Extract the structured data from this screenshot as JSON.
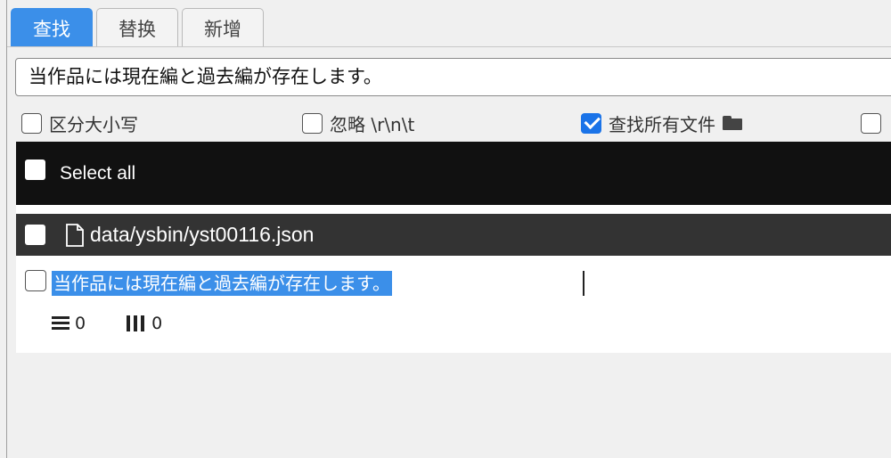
{
  "tabs": [
    {
      "label": "查找",
      "active": true
    },
    {
      "label": "替换",
      "active": false
    },
    {
      "label": "新增",
      "active": false
    }
  ],
  "search": {
    "value": "当作品には現在編と過去編が存在します。"
  },
  "options": {
    "case_sensitive": {
      "label": "区分大小写",
      "checked": false
    },
    "ignore_escapes": {
      "label": "忽略 \\r\\n\\t",
      "checked": false
    },
    "find_all_files": {
      "label": "查找所有文件",
      "checked": true,
      "icon": "folder-icon"
    },
    "fourth": {
      "checked": false
    }
  },
  "results": {
    "select_all_label": "Select all",
    "file": {
      "path": "data/ysbin/yst00116.json",
      "icon": "file-icon"
    },
    "match": {
      "text": "当作品には現在編と過去編が存在します。",
      "line": "0",
      "column": "0"
    }
  },
  "colors": {
    "accent": "#3b8fe9",
    "header_bar": "#111111",
    "file_bar": "#333333"
  }
}
